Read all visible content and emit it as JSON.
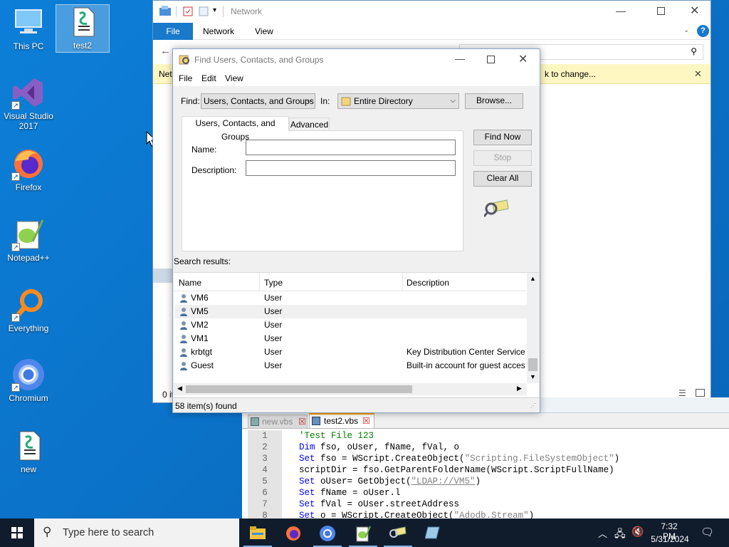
{
  "desktop": {
    "icons": [
      {
        "label": "This PC",
        "icon": "computer-icon"
      },
      {
        "label": "test2",
        "icon": "script-file-icon"
      },
      {
        "label": "Visual Studio 2017",
        "icon": "visual-studio-icon"
      },
      {
        "label": "Firefox",
        "icon": "firefox-icon"
      },
      {
        "label": "Notepad++",
        "icon": "notepadpp-icon"
      },
      {
        "label": "Everything",
        "icon": "everything-icon"
      },
      {
        "label": "Chromium",
        "icon": "chromium-icon"
      },
      {
        "label": "new",
        "icon": "script-file-icon"
      }
    ]
  },
  "explorer": {
    "title": "Network",
    "ribbon_tabs": [
      "File",
      "Network",
      "View"
    ],
    "nav_prefix": "Net",
    "info_bar_text": "k to change...",
    "status": "0 it"
  },
  "dialog": {
    "title": "Find Users, Contacts, and Groups",
    "menu": [
      "File",
      "Edit",
      "View"
    ],
    "find_label": "Find:",
    "find_value": "Users, Contacts, and Groups",
    "in_label": "In:",
    "in_value": "Entire Directory",
    "browse_button": "Browse...",
    "tabs": [
      "Users, Contacts, and Groups",
      "Advanced"
    ],
    "name_label": "Name:",
    "name_value": "",
    "description_label": "Description:",
    "description_value": "",
    "find_now_button": "Find Now",
    "stop_button": "Stop",
    "clear_all_button": "Clear All",
    "search_results_label": "Search results:",
    "columns": [
      "Name",
      "Type",
      "Description"
    ],
    "results": [
      {
        "name": "VM6",
        "type": "User",
        "description": ""
      },
      {
        "name": "VM5",
        "type": "User",
        "description": ""
      },
      {
        "name": "VM2",
        "type": "User",
        "description": ""
      },
      {
        "name": "VM1",
        "type": "User",
        "description": ""
      },
      {
        "name": "krbtgt",
        "type": "User",
        "description": "Key Distribution Center Service A"
      },
      {
        "name": "Guest",
        "type": "User",
        "description": "Built-in account for guest acces"
      }
    ],
    "status": "58 item(s) found"
  },
  "notepad": {
    "tabs": [
      "new.vbs",
      "test2.vbs"
    ],
    "lines": [
      {
        "n": "1",
        "parts": [
          {
            "t": "'Test File 123",
            "c": "cm"
          }
        ]
      },
      {
        "n": "2",
        "parts": [
          {
            "t": "Dim",
            "c": "kw"
          },
          {
            "t": " fso, oUser, fName, fVal, o",
            "c": ""
          }
        ]
      },
      {
        "n": "3",
        "parts": [
          {
            "t": "Set",
            "c": "kw"
          },
          {
            "t": " fso = WScript.CreateObject(",
            "c": ""
          },
          {
            "t": "\"Scripting.FileSystemObject\"",
            "c": "str"
          },
          {
            "t": ")",
            "c": ""
          }
        ]
      },
      {
        "n": "4",
        "parts": [
          {
            "t": "scriptDir = fso.GetParentFolderName(WScript.ScriptFullName)",
            "c": ""
          }
        ]
      },
      {
        "n": "5",
        "parts": [
          {
            "t": "Set",
            "c": "kw"
          },
          {
            "t": " oUser= GetObject(",
            "c": ""
          },
          {
            "t": "\"LDAP://VM5\"",
            "c": "str"
          },
          {
            "t": ")",
            "c": ""
          }
        ]
      },
      {
        "n": "6",
        "parts": [
          {
            "t": "Set",
            "c": "kw"
          },
          {
            "t": " fName = oUser.l",
            "c": ""
          }
        ]
      },
      {
        "n": "7",
        "parts": [
          {
            "t": "Set",
            "c": "kw"
          },
          {
            "t": " fVal = oUser.streetAddress",
            "c": ""
          }
        ]
      },
      {
        "n": "8",
        "parts": [
          {
            "t": "Set",
            "c": "kw"
          },
          {
            "t": " o = WScript.CreateObject(",
            "c": ""
          },
          {
            "t": "\"Adodb.Stream\"",
            "c": "str"
          },
          {
            "t": ")",
            "c": ""
          }
        ]
      }
    ]
  },
  "taskbar": {
    "search_placeholder": "Type here to search",
    "time": "7:32 PM",
    "date": "5/31/2024"
  },
  "colors": {
    "desktop": "#0a78d4",
    "ribbon_file": "#1979ca",
    "taskbar": "#101c2c",
    "info_bar": "#fff7c2"
  }
}
